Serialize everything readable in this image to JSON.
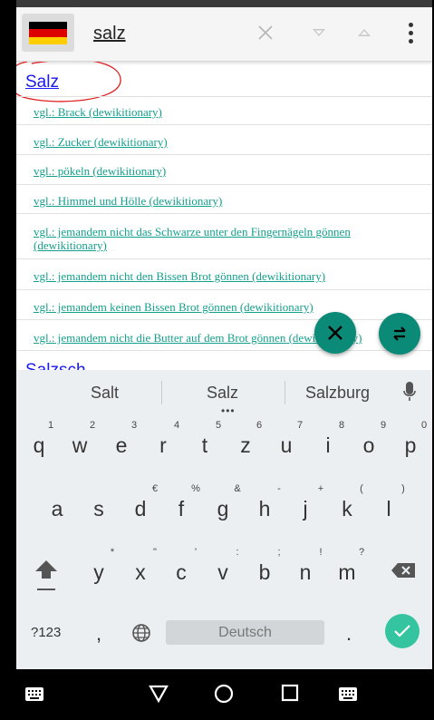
{
  "header": {
    "flag_icon": "germany-flag-icon",
    "flag_colors": [
      "#000000",
      "#dd0000",
      "#ffce00"
    ],
    "search_value": "salz",
    "icons": [
      "close-icon",
      "triangle-down-icon",
      "triangle-up-icon",
      "more-vert-icon"
    ]
  },
  "results": {
    "title": "Salz",
    "links": [
      "vgl.: Brack (dewikitionary)",
      "vgl.: Zucker (dewikitionary)",
      "vgl.: pökeln (dewikitionary)",
      "vgl.: Himmel und Hölle (dewikitionary)",
      "vgl.: jemandem nicht das Schwarze unter den Fingernägeln gönnen (dewikitionary)",
      "vgl.: jemandem nicht den Bissen Brot gönnen (dewikitionary)",
      "vgl.: jemandem keinen Bissen Brot gönnen (dewikitionary)",
      "vgl.: jemandem nicht die Butter auf dem Brot gönnen (dewikitionary)"
    ],
    "next_title": "Salzsch",
    "link_color": "#14a08c",
    "title_color": "#1a1aee"
  },
  "fabs": {
    "close_icon": "close-icon",
    "swap_icon": "swap-icon",
    "color": "#0c8a78"
  },
  "keyboard": {
    "suggestions": [
      "Salt",
      "Salz",
      "Salzburg"
    ],
    "row1": [
      "q",
      "w",
      "e",
      "r",
      "t",
      "z",
      "u",
      "i",
      "o",
      "p"
    ],
    "row1_hints": [
      "1",
      "2",
      "3",
      "4",
      "5",
      "6",
      "7",
      "8",
      "9",
      "0"
    ],
    "row2": [
      "a",
      "s",
      "d",
      "f",
      "g",
      "h",
      "j",
      "k",
      "l"
    ],
    "row2_hints": [
      "€",
      "%",
      "&",
      "-",
      "+",
      "(",
      ")"
    ],
    "row3": [
      "y",
      "x",
      "c",
      "v",
      "b",
      "n",
      "m"
    ],
    "row3_hints": [
      "*",
      "\"",
      "'",
      ":",
      ";",
      "!",
      "?"
    ],
    "symbols_label": "?123",
    "comma": ",",
    "space_label": "Deutsch",
    "period": ".",
    "enter_color": "#35c4a0"
  },
  "navbar": {
    "icons": [
      "keyboard-icon",
      "back-icon",
      "home-icon",
      "recents-icon",
      "keyboard-icon"
    ]
  }
}
